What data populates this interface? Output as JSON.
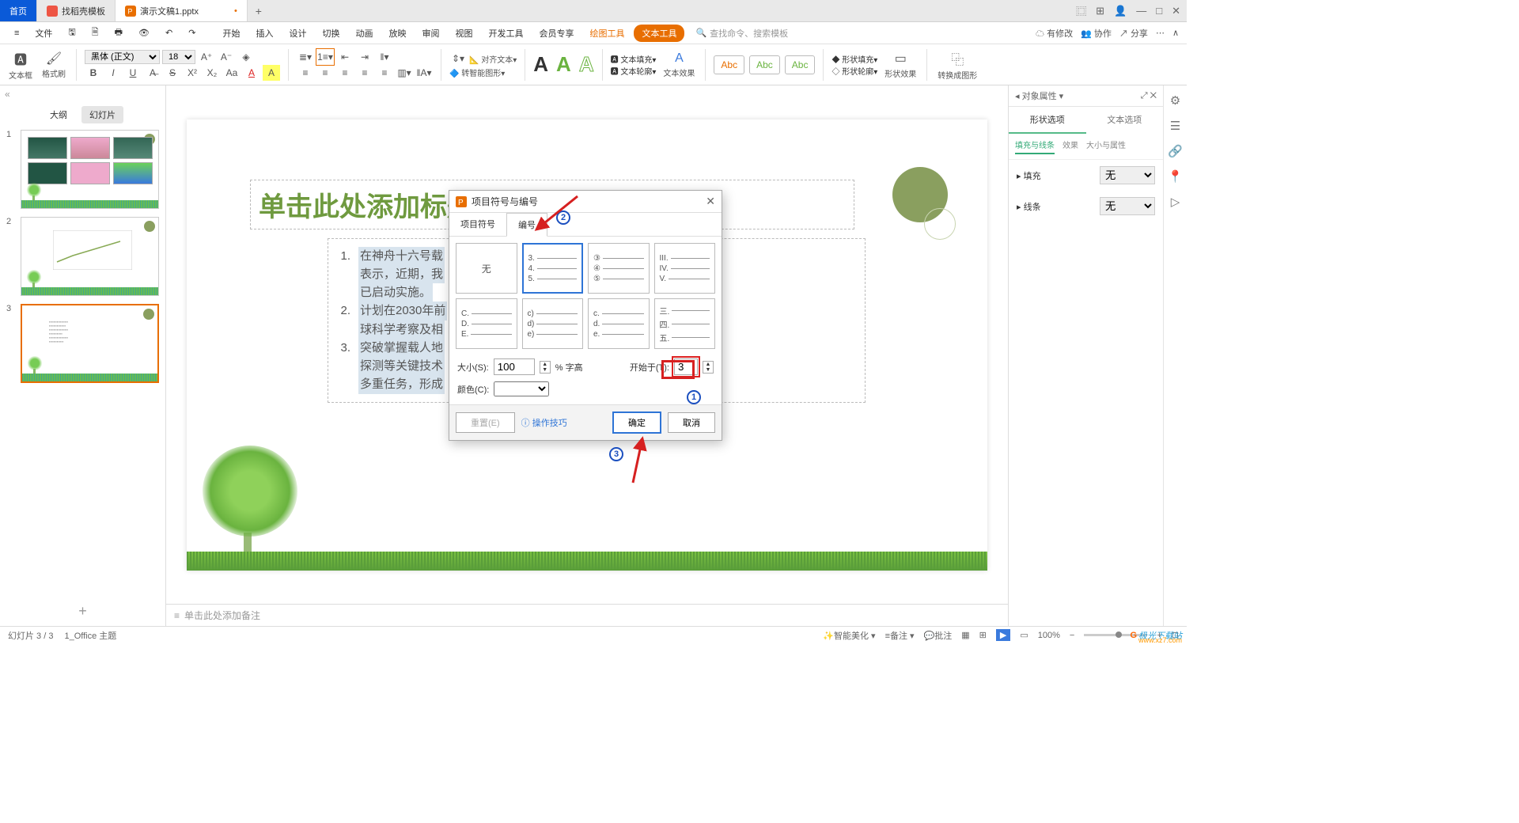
{
  "titlebar": {
    "home": "首页",
    "tab1": "找稻壳模板",
    "tab2": "演示文稿1.pptx"
  },
  "menubar": {
    "file": "文件",
    "items": [
      "开始",
      "插入",
      "设计",
      "切换",
      "动画",
      "放映",
      "审阅",
      "视图",
      "开发工具",
      "会员专享"
    ],
    "tool1": "绘图工具",
    "tool2": "文本工具",
    "search_ph": "查找命令、搜索模板",
    "right_edit": "有修改",
    "right_coop": "协作",
    "right_share": "分享"
  },
  "toolbar": {
    "textbox": "文本框",
    "brush": "格式刷",
    "font": "黑体 (正文)",
    "size": "18",
    "smart": "转智能图形",
    "textfill": "文本填充",
    "textoutline": "文本轮廓",
    "texteffect": "文本效果",
    "shapefill": "形状填充",
    "shapeoutline": "形状轮廓",
    "shapeeffect": "形状效果",
    "convert": "转换成图形"
  },
  "sidepanel": {
    "tab_outline": "大纲",
    "tab_slides": "幻灯片"
  },
  "slide": {
    "title_ph": "单击此处添加标题",
    "items": [
      {
        "n": "1.",
        "t": "在神舟十六号载"
      },
      {
        "n": "",
        "t": "表示，近期，我"
      },
      {
        "n": "",
        "t": "已启动实施。"
      },
      {
        "n": "2.",
        "t": "计划在2030年前"
      },
      {
        "n": "",
        "t": "球科学考察及相"
      },
      {
        "n": "3.",
        "t": "突破掌握载人地"
      },
      {
        "n": "",
        "t": "探测等关键技术"
      },
      {
        "n": "",
        "t": "多重任务，形成"
      }
    ],
    "notes_ph": "单击此处添加备注"
  },
  "prop": {
    "header": "对象属性",
    "tab_shape": "形状选项",
    "tab_text": "文本选项",
    "sub1": "填充与线条",
    "sub2": "效果",
    "sub3": "大小与属性",
    "fill": "填充",
    "line": "线条",
    "none": "无"
  },
  "dialog": {
    "title": "项目符号与编号",
    "tab_bullet": "项目符号",
    "tab_number": "编号",
    "none": "无",
    "cells": [
      [
        "3.",
        "4.",
        "5."
      ],
      [
        "③",
        "④",
        "⑤"
      ],
      [
        "III.",
        "IV.",
        "V."
      ],
      [
        "C.",
        "D.",
        "E."
      ],
      [
        "c)",
        "d)",
        "e)"
      ],
      [
        "c.",
        "d.",
        "e."
      ],
      [
        "三.",
        "四.",
        "五."
      ]
    ],
    "size_lbl": "大小(S):",
    "size_val": "100",
    "size_unit": "% 字高",
    "start_lbl": "开始于(T):",
    "start_val": "3",
    "color_lbl": "颜色(C):",
    "reset": "重置(E)",
    "tips": "操作技巧",
    "ok": "确定",
    "cancel": "取消"
  },
  "status": {
    "page": "幻灯片 3 / 3",
    "theme": "1_Office 主题",
    "beautify": "智能美化",
    "notes": "备注",
    "comment": "批注",
    "zoom": "100%"
  },
  "badges": {
    "b1": "1",
    "b2": "2",
    "b3": "3"
  },
  "watermark": {
    "brand": "极光下载站",
    "url": "www.xz7.com"
  }
}
